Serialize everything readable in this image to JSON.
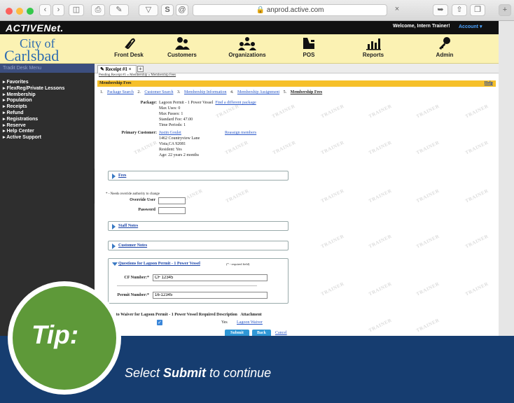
{
  "browser": {
    "url": "anprod.active.com"
  },
  "header": {
    "logo": "ACTIVENet.",
    "welcome": "Welcome, Intern Trainer!",
    "account": "Account ▾"
  },
  "city": {
    "line1": "City of",
    "line2": "Carlsbad"
  },
  "nav": [
    "Front Desk",
    "Customers",
    "Organizations",
    "POS",
    "Reports",
    "Admin"
  ],
  "sidebar": {
    "header": "Tradit Desk Menu",
    "items": [
      "Favorites",
      "FlexReg/Private Lessons",
      "Membership",
      "Population",
      "Receipts",
      "Refund",
      "Registrations",
      "Reserve",
      "Help Center",
      "Active Support"
    ]
  },
  "tab": {
    "label": "Receipt #1 ×",
    "plus": "+"
  },
  "breadcrumb": "Pending Receipt #1 » Membership » Membership Fees",
  "page": {
    "title": "Membership Fees",
    "help": "Help"
  },
  "steps": [
    {
      "num": "1.",
      "label": "Package Search"
    },
    {
      "num": "2.",
      "label": "Customer Search"
    },
    {
      "num": "3.",
      "label": "Membership Information"
    },
    {
      "num": "4.",
      "label": "Membership Assignment"
    },
    {
      "num": "5.",
      "label": "Membership Fees"
    }
  ],
  "package": {
    "label": "Package:",
    "name": "Lagoon Permit - 1 Power Vessel",
    "change_link": "Find a different package",
    "details": [
      "Max Uses: 0",
      "Max Passes: 1",
      "Standard Fee: 47.00",
      "Time Periods: 1"
    ]
  },
  "customer": {
    "label": "Primary Customer:",
    "name": "Justin Goulet",
    "reassign": "Reassign members",
    "details": [
      "1462 Countryview Lane",
      "Vista,CA 92081",
      "Resident: Yes",
      "Age: 22 years 2 months"
    ]
  },
  "panels": {
    "fees": "Fees",
    "staff_notes": "Staff Notes",
    "customer_notes": "Customer Notes"
  },
  "override": {
    "note": "* - Needs override authority to change",
    "user_label": "Override User",
    "password_label": "Password",
    "user_value": "",
    "password_value": ""
  },
  "questions": {
    "title": "Questions for Lagoon Permit - 1 Power Vessel",
    "required_note": "(* - required field)",
    "cf_label": "CF Number:*",
    "cf_value": "CF 12345",
    "permit_label": "Permit Number:*",
    "permit_value": "16-12345"
  },
  "waiver": {
    "header": "Agree to Waiver for Lagoon Permit - 1 Power Vessel",
    "required_header": "Required",
    "description_header": "Description",
    "attachment_header": "Attachment",
    "required": "Yes",
    "description": "Lagoon Waiver",
    "checked": true
  },
  "buttons": {
    "submit": "Submit",
    "back": "Back",
    "cancel": "Cancel"
  },
  "watermark": "TRAINER",
  "tip": {
    "label": "Tip:",
    "text_before": "Select ",
    "text_bold": "Submit",
    "text_after": " to continue"
  },
  "colors": {
    "accent_yellow": "#f6c02a",
    "nav_bg": "#fbf2b3",
    "tip_bg": "#163d70",
    "tip_green": "#5e9939",
    "button_blue": "#2f97d6"
  }
}
